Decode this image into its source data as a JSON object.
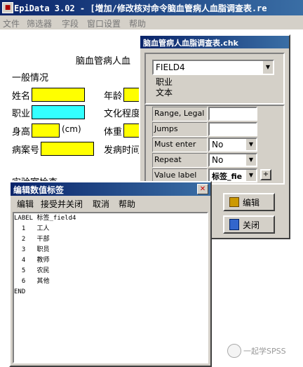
{
  "app": {
    "title": "EpiData 3.02 - [增加/修改核对命令脑血管病人血脂调查表.re",
    "menu": [
      "文件",
      "筛选器",
      "字段",
      "窗口设置",
      "帮助"
    ]
  },
  "form": {
    "heading": "脑血管病人血",
    "section_general": "一般情况",
    "labels": {
      "name": "姓名",
      "age": "年龄",
      "occupation": "职业",
      "education": "文化程度",
      "height": "身高",
      "height_unit": "(cm)",
      "weight": "体重",
      "case_no": "病案号",
      "onset_time": "发病时间",
      "lab": "实验室检查"
    }
  },
  "chk_dialog": {
    "title": "脑血管病人血脂调查表.chk",
    "field_select": "FIELD4",
    "field_label": "职业",
    "field_type": "文本",
    "rows": [
      {
        "label": "Range, Legal",
        "value": ""
      },
      {
        "label": "Jumps",
        "value": ""
      },
      {
        "label": "Must enter",
        "value": "No"
      },
      {
        "label": "Repeat",
        "value": "No"
      },
      {
        "label": "Value label",
        "value": "标签_fie"
      }
    ],
    "plus_button": "+",
    "edit_button": "编辑",
    "close_button": "关闭"
  },
  "value_label_editor": {
    "title": "编辑数值标签",
    "menu": [
      "编辑",
      "接受并关闭",
      "取消",
      "帮助"
    ],
    "lines": [
      "LABEL 标签_field4",
      "  1   工人",
      "  2   干部",
      "  3   职员",
      "  4   教师",
      "  5   农民",
      "  6   其他",
      "END"
    ]
  },
  "watermark": "一起学SPSS"
}
